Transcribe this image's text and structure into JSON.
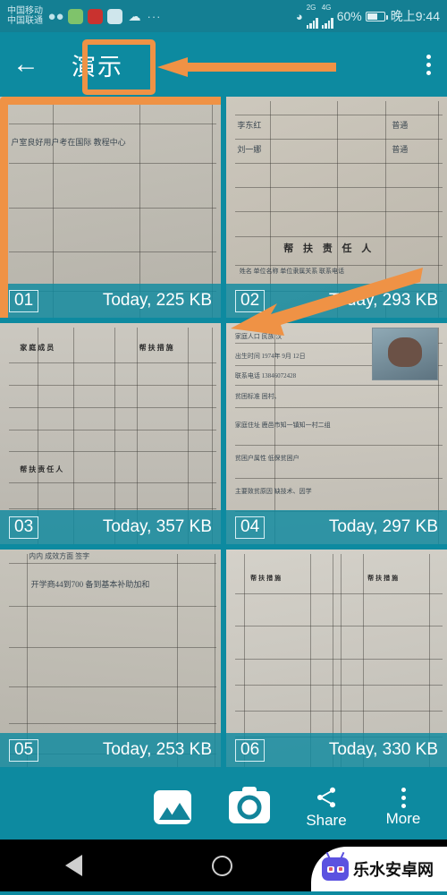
{
  "status_bar": {
    "carrier_line1": "中国移动",
    "carrier_line2": "中国联通",
    "icons": [
      "wechat-icon",
      "contacts-icon",
      "alipay-icon",
      "link-icon",
      "weather-icon",
      "more-dots-icon"
    ],
    "network_2g": "2G",
    "network_4g": "4G",
    "battery_percent": "60%",
    "time": "晚上9:44"
  },
  "app_bar": {
    "back_label": "←",
    "title": "演示",
    "overflow_label": "More options"
  },
  "grid": {
    "items": [
      {
        "num": "01",
        "meta": "Today, 225 KB",
        "selected": true
      },
      {
        "num": "02",
        "meta": "Today, 293 KB",
        "selected": false
      },
      {
        "num": "03",
        "meta": "Today, 357 KB",
        "selected": false
      },
      {
        "num": "04",
        "meta": "Today, 297 KB",
        "selected": false
      },
      {
        "num": "05",
        "meta": "Today, 253 KB",
        "selected": false
      },
      {
        "num": "06",
        "meta": "Today, 330 KB",
        "selected": false
      }
    ],
    "thumb_text": {
      "t1_row": "户室良好用户考在国际    教程中心",
      "t2_name1": "李东红",
      "t2_name2": "刘一娜",
      "t2_tag1": "普通",
      "t2_tag2": "普通",
      "t2_heading": "帮 扶 责 任 人",
      "t2_cols": "姓名   单位名称   单位隶属关系   联系电话",
      "t3_h1": "家庭成员",
      "t3_h2": "帮扶措施",
      "t3_h3": "帮扶责任人",
      "t4_l1": "家庭人口   民族  汉",
      "t4_l2": "出生时间  1974年 9月 12日",
      "t4_l3": "联系电话  13846072428",
      "t4_l4": "贫困标准  困村、",
      "t4_l5": "家庭住址  鹿邑市知一镇知一村二组",
      "t4_l6": "贫困户属性  低保贫困户",
      "t4_l7": "主要致贫原因  缺技术、因学",
      "t5_cols": "内内        成效方面        签字",
      "t5_scrawl": "开学商44到700  备到基本补助加和",
      "t6_h1": "帮扶措施",
      "t6_h2": "帮扶措施"
    }
  },
  "bottom_bar": {
    "gallery_label": "gallery-icon",
    "camera_label": "camera-icon",
    "share_label": "Share",
    "more_label": "More"
  },
  "nav_bar": {
    "back": "back-button",
    "home": "home-button",
    "recents": "recents-button"
  },
  "watermark": {
    "text": "乐水安卓网"
  },
  "colors": {
    "teal_primary": "#0d8aa0",
    "teal_status": "#147f93",
    "orange_highlight": "#ef9245",
    "caption_overlay": "rgba(15,138,160,.82)"
  }
}
